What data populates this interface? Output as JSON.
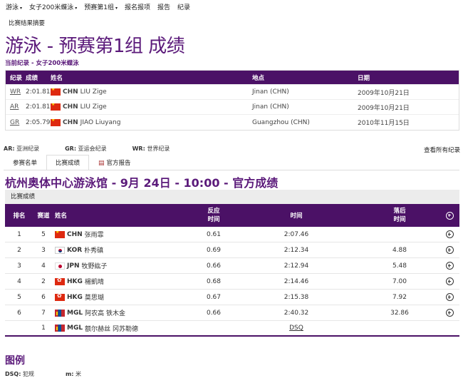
{
  "nav": {
    "items": [
      {
        "label": "游泳",
        "dropdown": true
      },
      {
        "label": "女子200米蝶泳",
        "dropdown": true
      },
      {
        "label": "预赛第1组",
        "dropdown": true
      },
      {
        "label": "报名报项",
        "dropdown": false
      },
      {
        "label": "报告",
        "dropdown": false
      },
      {
        "label": "纪录",
        "dropdown": false
      }
    ]
  },
  "summary_link": "比赛结果摘要",
  "page_title": "游泳 - 预赛第1组 成绩",
  "subtitle": "当前纪录 - 女子200米蝶泳",
  "records": {
    "headers": {
      "type": "纪录",
      "result": "成绩",
      "name": "姓名",
      "location": "地点",
      "date": "日期"
    },
    "rows": [
      {
        "type": "WR",
        "result": "2:01.81",
        "noc": "CHN",
        "flag": "chn",
        "name": "LIU Zige",
        "location": "Jinan (CHN)",
        "date": "2009年10月21日"
      },
      {
        "type": "AR",
        "result": "2:01.81",
        "noc": "CHN",
        "flag": "chn",
        "name": "LIU Zige",
        "location": "Jinan (CHN)",
        "date": "2009年10月21日"
      },
      {
        "type": "GR",
        "result": "2:05.79",
        "noc": "CHN",
        "flag": "chn",
        "name": "JIAO Liuyang",
        "location": "Guangzhou (CHN)",
        "date": "2010年11月15日"
      }
    ]
  },
  "record_legend": [
    {
      "code": "AR:",
      "text": "亚洲纪录"
    },
    {
      "code": "GR:",
      "text": "亚运会纪录"
    },
    {
      "code": "WR:",
      "text": "世界纪录"
    }
  ],
  "view_all": "查看所有纪录",
  "tabs": [
    {
      "label": "参赛名单",
      "active": false,
      "icon": false
    },
    {
      "label": "比赛成绩",
      "active": true,
      "icon": false
    },
    {
      "label": "官方报告",
      "active": false,
      "icon": true
    }
  ],
  "venue_title": "杭州奥体中心游泳馆 - 9月 24日 - 10:00 - 官方成绩",
  "results": {
    "caption": "比赛成绩",
    "headers": {
      "rank": "排名",
      "lane": "赛道",
      "name": "姓名",
      "reaction": "反应\n时间",
      "time": "时间",
      "behind": "落后\n时间"
    },
    "rows": [
      {
        "rank": "1",
        "lane": "5",
        "noc": "CHN",
        "flag": "chn",
        "name": "张雨霏",
        "reaction": "0.61",
        "time": "2:07.46",
        "behind": ""
      },
      {
        "rank": "2",
        "lane": "3",
        "noc": "KOR",
        "flag": "kor",
        "name": "朴秀磌",
        "reaction": "0.69",
        "time": "2:12.34",
        "behind": "4.88"
      },
      {
        "rank": "3",
        "lane": "4",
        "noc": "JPN",
        "flag": "jpn",
        "name": "牧野紘子",
        "reaction": "0.66",
        "time": "2:12.94",
        "behind": "5.48"
      },
      {
        "rank": "4",
        "lane": "2",
        "noc": "HKG",
        "flag": "hkg",
        "name": "楊凱晴",
        "reaction": "0.68",
        "time": "2:14.46",
        "behind": "7.00"
      },
      {
        "rank": "5",
        "lane": "6",
        "noc": "HKG",
        "flag": "hkg",
        "name": "莫思瑚",
        "reaction": "0.67",
        "time": "2:15.38",
        "behind": "7.92"
      },
      {
        "rank": "6",
        "lane": "7",
        "noc": "MGL",
        "flag": "mgl",
        "name": "阿农高 铁木金",
        "reaction": "0.66",
        "time": "2:40.32",
        "behind": "32.86"
      },
      {
        "rank": "",
        "lane": "1",
        "noc": "MGL",
        "flag": "mgl",
        "name": "额尔赫丝 冈苏勒德",
        "reaction": "",
        "time": "DSQ",
        "behind": ""
      }
    ]
  },
  "legend": {
    "title": "图例",
    "items": [
      {
        "code": "DSQ:",
        "text": "犯规"
      },
      {
        "code": "m:",
        "text": "米"
      }
    ]
  }
}
